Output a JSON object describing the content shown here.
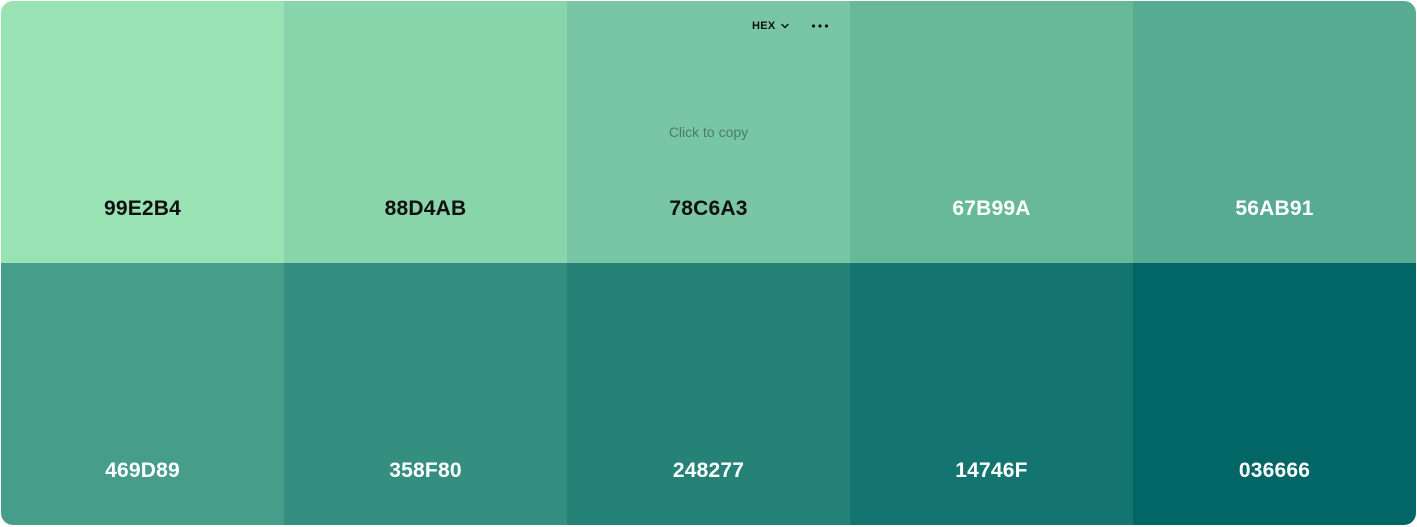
{
  "toolbar": {
    "format_label": "HEX",
    "format_icon": "chevron-down-icon",
    "more_icon": "more-horizontal-icon"
  },
  "hint": {
    "text": "Click to copy"
  },
  "swatches": [
    {
      "hex": "99E2B4",
      "color": "#99E2B4",
      "text_color": "#111111"
    },
    {
      "hex": "88D4AB",
      "color": "#88D4AB",
      "text_color": "#111111"
    },
    {
      "hex": "78C6A3",
      "color": "#78C6A3",
      "text_color": "#111111"
    },
    {
      "hex": "67B99A",
      "color": "#67B99A",
      "text_color": "#ffffff"
    },
    {
      "hex": "56AB91",
      "color": "#56AB91",
      "text_color": "#ffffff"
    },
    {
      "hex": "469D89",
      "color": "#469D89",
      "text_color": "#ffffff"
    },
    {
      "hex": "358F80",
      "color": "#358F80",
      "text_color": "#ffffff"
    },
    {
      "hex": "248277",
      "color": "#248277",
      "text_color": "#ffffff"
    },
    {
      "hex": "14746F",
      "color": "#14746F",
      "text_color": "#ffffff"
    },
    {
      "hex": "036666",
      "color": "#036666",
      "text_color": "#ffffff"
    }
  ]
}
